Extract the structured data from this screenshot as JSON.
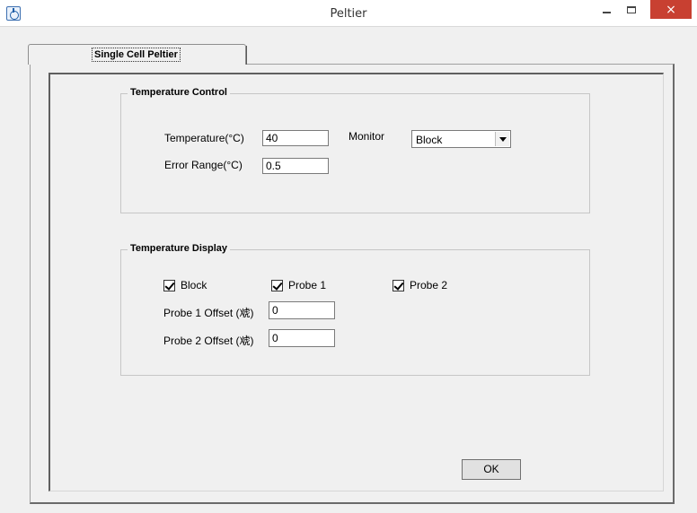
{
  "window": {
    "title": "Peltier",
    "close_glyph": "×"
  },
  "tabs": [
    {
      "label": "Single Cell Peltier",
      "active": true
    }
  ],
  "temperature_control": {
    "title": "Temperature Control",
    "temperature_label": "Temperature(°C)",
    "temperature_value": "40",
    "error_range_label": "Error Range(°C)",
    "error_range_value": "0.5",
    "monitor_label": "Monitor",
    "monitor_selected": "Block"
  },
  "temperature_display": {
    "title": "Temperature Display",
    "checkboxes": [
      {
        "label": "Block",
        "checked": true
      },
      {
        "label": "Probe 1",
        "checked": true
      },
      {
        "label": "Probe 2",
        "checked": true
      }
    ],
    "probe1_offset_label": "Probe 1 Offset (䖊)",
    "probe1_offset_value": "0",
    "probe2_offset_label": "Probe 2 Offset (䖊)",
    "probe2_offset_value": "0"
  },
  "ok_label": "OK",
  "icons": {
    "app": "stopwatch-icon",
    "minimize": "minimize-icon",
    "maximize": "maximize-icon",
    "close": "close-icon"
  },
  "colors": {
    "close_button": "#c84031",
    "background": "#f0f0f0"
  }
}
